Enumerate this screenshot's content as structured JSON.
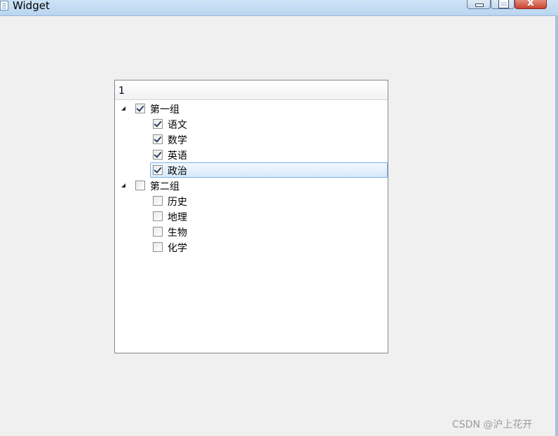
{
  "window": {
    "title": "Widget"
  },
  "tree": {
    "header": "1",
    "groups": [
      {
        "label": "第一组",
        "checked": true,
        "expanded": true,
        "children": [
          {
            "label": "语文",
            "checked": true
          },
          {
            "label": "数学",
            "checked": true
          },
          {
            "label": "英语",
            "checked": true
          },
          {
            "label": "政治",
            "checked": true,
            "selected": true
          }
        ]
      },
      {
        "label": "第二组",
        "checked": false,
        "expanded": true,
        "children": [
          {
            "label": "历史",
            "checked": false
          },
          {
            "label": "地理",
            "checked": false
          },
          {
            "label": "生物",
            "checked": false
          },
          {
            "label": "化学",
            "checked": false
          }
        ]
      }
    ]
  },
  "watermark": "CSDN @沪上花开"
}
